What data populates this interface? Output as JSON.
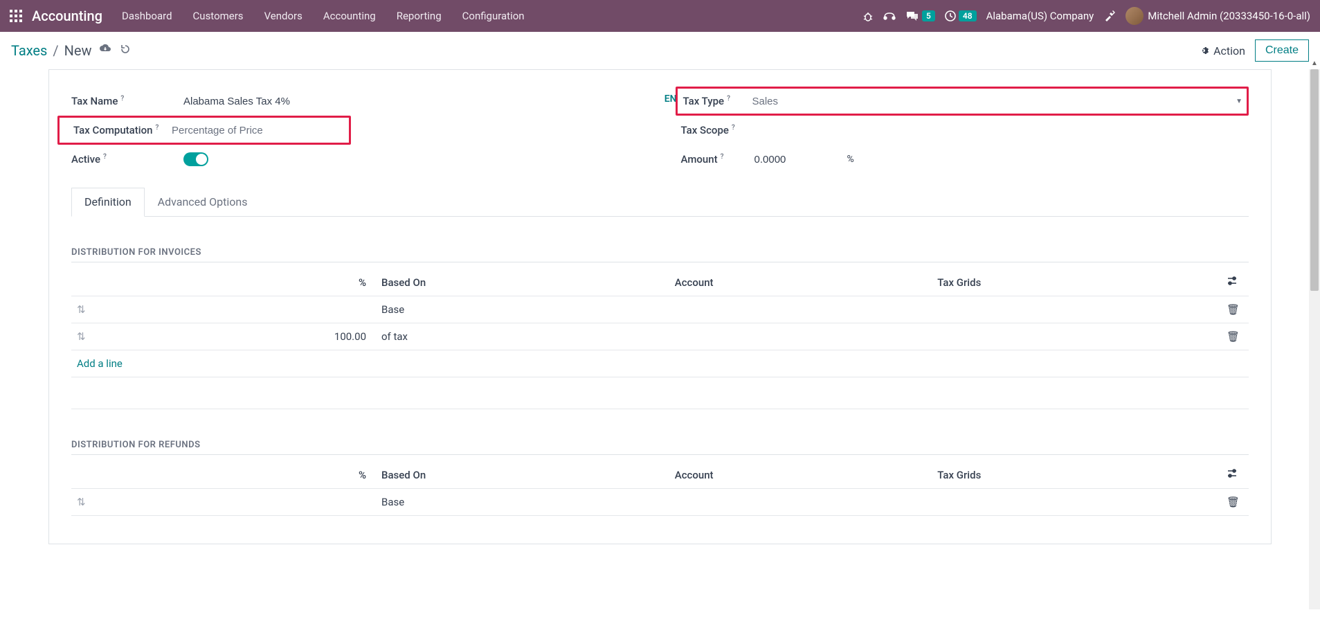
{
  "navbar": {
    "brand": "Accounting",
    "menu": [
      "Dashboard",
      "Customers",
      "Vendors",
      "Accounting",
      "Reporting",
      "Configuration"
    ],
    "badge_messages": "5",
    "badge_activities": "48",
    "company": "Alabama(US) Company",
    "user": "Mitchell Admin (20333450-16-0-all)"
  },
  "breadcrumb": {
    "root": "Taxes",
    "current": "New",
    "action_label": "Action",
    "create_label": "Create"
  },
  "form": {
    "tax_name_label": "Tax Name",
    "tax_name_value": "Alabama Sales Tax 4%",
    "lang_badge": "EN",
    "tax_computation_label": "Tax Computation",
    "tax_computation_value": "Percentage of Price",
    "active_label": "Active",
    "tax_type_label": "Tax Type",
    "tax_type_value": "Sales",
    "tax_scope_label": "Tax Scope",
    "amount_label": "Amount",
    "amount_value": "0.0000",
    "amount_unit": "%"
  },
  "tabs": {
    "definition": "Definition",
    "advanced": "Advanced Options"
  },
  "distributions": {
    "invoices_title": "DISTRIBUTION FOR INVOICES",
    "refunds_title": "DISTRIBUTION FOR REFUNDS",
    "headers": {
      "pct": "%",
      "based_on": "Based On",
      "account": "Account",
      "grids": "Tax Grids"
    },
    "invoices": [
      {
        "pct": "",
        "based_on": "Base"
      },
      {
        "pct": "100.00",
        "based_on": "of tax"
      }
    ],
    "refunds": [
      {
        "pct": "",
        "based_on": "Base"
      }
    ],
    "add_line": "Add a line"
  }
}
